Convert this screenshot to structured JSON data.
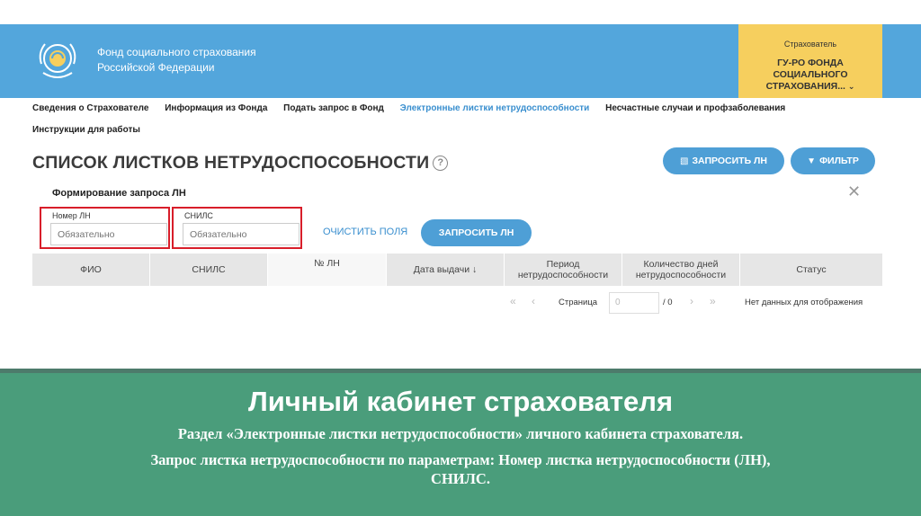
{
  "header": {
    "org_line1": "Фонд социального страхования",
    "org_line2": "Российской Федерации",
    "account_role": "Страхователь",
    "account_name": "ГУ-РО ФОНДА СОЦИАЛЬНОГО СТРАХОВАНИЯ...",
    "brand_color": "#53a6dc",
    "account_color": "#f6cf5e"
  },
  "nav": {
    "items": [
      "Сведения о Страхователе",
      "Информация из Фонда",
      "Подать запрос в Фонд",
      "Электронные листки нетрудоспособности",
      "Несчастные случаи и профзаболевания",
      "Инструкции для работы"
    ],
    "active_index": 3
  },
  "page": {
    "title": "СПИСОК ЛИСТКОВ НЕТРУДОСПОСОБНОСТИ",
    "help_glyph": "?",
    "request_button": "ЗАПРОСИТЬ ЛН",
    "filter_button": "ФИЛЬТР"
  },
  "form": {
    "title": "Формирование запроса ЛН",
    "ln_label": "Номер ЛН",
    "ln_placeholder": "Обязательно",
    "snils_label": "СНИЛС",
    "snils_placeholder": "Обязательно",
    "clear_button": "ОЧИСТИТЬ ПОЛЯ",
    "submit_button": "ЗАПРОСИТЬ ЛН"
  },
  "table": {
    "columns": [
      "ФИО",
      "СНИЛС",
      "№ ЛН",
      "Дата выдачи ↓",
      "Период нетрудоспособности",
      "Количество дней нетрудоспособности",
      "Статус"
    ]
  },
  "pager": {
    "page_label": "Страница",
    "page_value": "0",
    "total": "/ 0",
    "empty_text": "Нет данных для отображения"
  },
  "banner": {
    "heading": "Личный кабинет страхователя",
    "line1": "Раздел «Электронные листки нетрудоспособности» личного кабинета страхователя.",
    "line2": "Запрос листка нетрудоспособности по параметрам: Номер листка нетрудоспособности (ЛН), СНИЛС.",
    "color": "#4a9d7b"
  }
}
